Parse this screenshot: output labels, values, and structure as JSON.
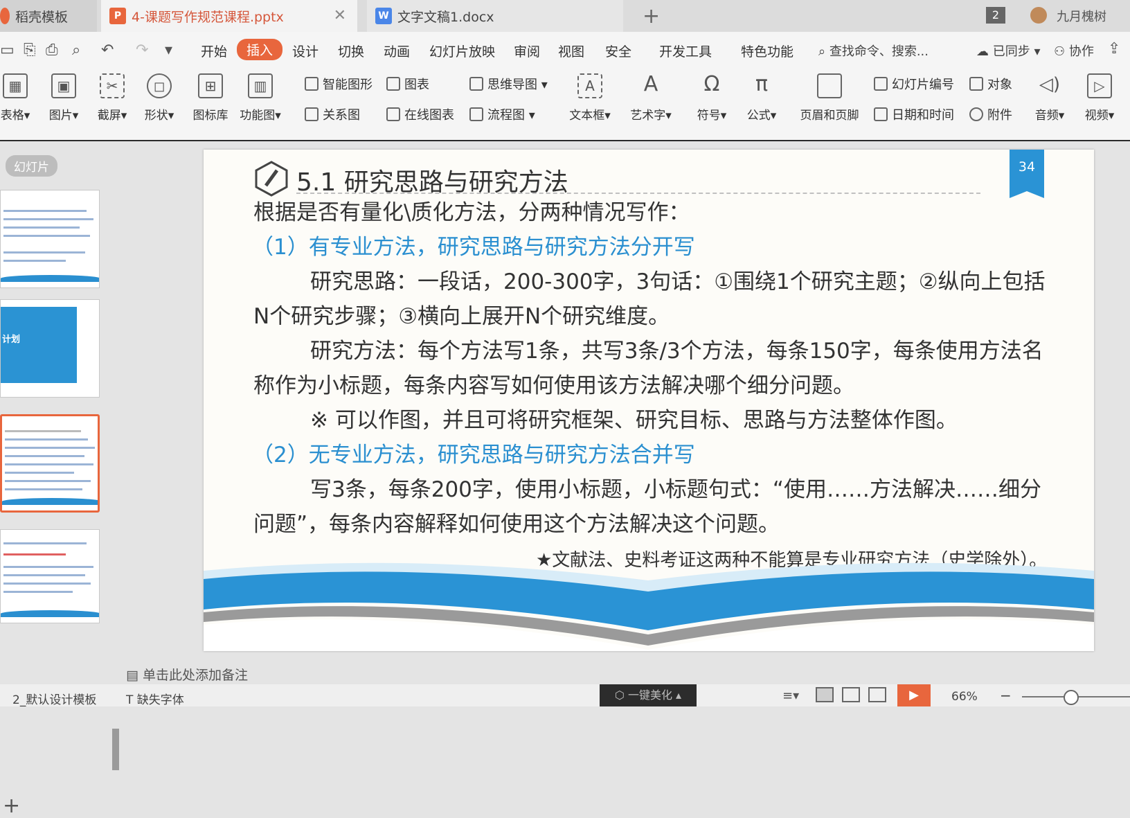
{
  "tabs": [
    {
      "label": "稻壳模板"
    },
    {
      "label": "4-课题写作规范课程.pptx",
      "icon": "P"
    },
    {
      "label": "文字文稿1.docx",
      "icon": "W"
    }
  ],
  "window": {
    "count_badge": "2",
    "user_name": "九月槐树"
  },
  "menu": {
    "items": [
      "开始",
      "插入",
      "设计",
      "切换",
      "动画",
      "幻灯片放映",
      "审阅",
      "视图",
      "安全",
      "开发工具",
      "特色功能"
    ],
    "active": "插入",
    "search": "查找命令、搜索...",
    "synced": "已同步",
    "collab": "协作"
  },
  "ribbon": {
    "table": "表格",
    "picture": "图片",
    "screenshot": "截屏",
    "shape": "形状",
    "icon_lib": "图标库",
    "func_chart": "功能图",
    "smart_shape": "智能图形",
    "chart": "图表",
    "mindmap": "思维导图",
    "relation": "关系图",
    "online_chart": "在线图表",
    "flowchart": "流程图",
    "textbox": "文本框",
    "wordart": "艺术字",
    "symbol": "符号",
    "formula": "公式",
    "header_footer": "页眉和页脚",
    "slide_number": "幻灯片编号",
    "object": "对象",
    "datetime": "日期和时间",
    "attachment": "附件",
    "audio": "音频",
    "video": "视频"
  },
  "left_panel": {
    "label": "幻灯片",
    "thumb_title": "计划"
  },
  "slide": {
    "number": "34",
    "title": "5.1 研究思路与研究方法",
    "lines": [
      "根据是否有量化\\质化方法，分两种情况写作：",
      "（1）有专业方法，研究思路与研究方法分开写",
      "研究思路：一段话，200-300字，3句话：①围绕1个研究主题；②纵向上包括",
      "N个研究步骤；③横向上展开N个研究维度。",
      "研究方法：每个方法写1条，共写3条/3个方法，每条150字，每条使用方法名",
      "称作为小标题，每条内容写如何使用该方法解决哪个细分问题。",
      "※ 可以作图，并且可将研究框架、研究目标、思路与方法整体作图。",
      "（2）无专业方法，研究思路与研究方法合并写",
      "写3条，每条200字，使用小标题，小标题句式：“使用……方法解决……细分",
      "问题”，每条内容解释如何使用这个方法解决这个问题。",
      "★文献法、史料考证这两种不能算是专业研究方法（史学除外）。"
    ]
  },
  "notes_placeholder": "单击此处添加备注",
  "status": {
    "template": "2_默认设计模板",
    "missing_font": "缺失字体",
    "beautify": "一键美化",
    "zoom": "66%"
  },
  "colors": {
    "accent": "#e8663d",
    "slide_blue": "#2a8fd0"
  }
}
